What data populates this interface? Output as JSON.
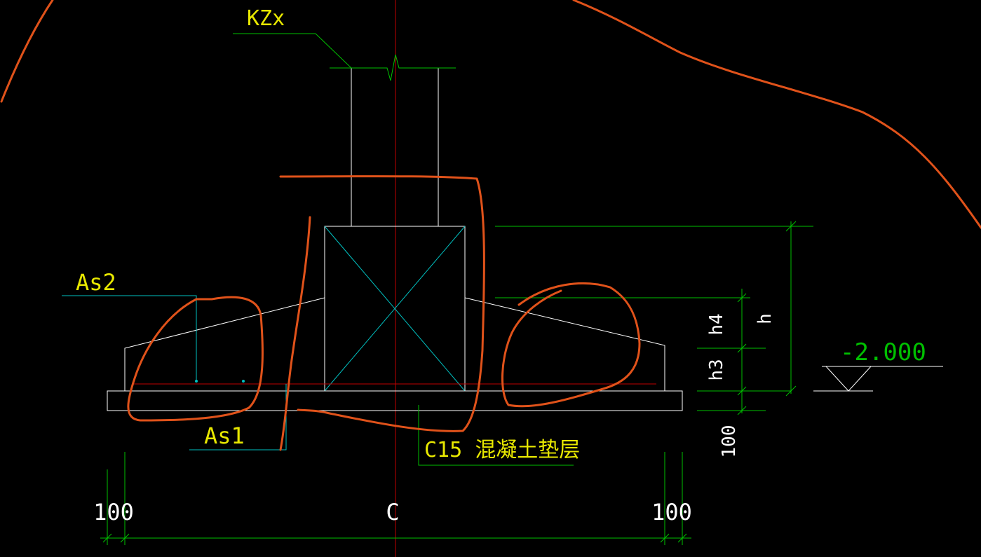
{
  "labels": {
    "column": "KZx",
    "top_rebar": "As2",
    "bottom_rebar": "As1",
    "cushion": "C15 混凝土垫层",
    "elevation": "-2.000",
    "dim_h": "h",
    "dim_h4": "h4",
    "dim_h3": "h3",
    "dim_cushion": "100",
    "dim_left": "100",
    "dim_center": "C",
    "dim_right": "100"
  },
  "colors": {
    "background": "#000000",
    "outline": "#ffffff",
    "leader": "#00c000",
    "dimension": "#00c000",
    "rebar_cyan": "#00c0c0",
    "axis": "#c00000",
    "markup": "#e0521a",
    "text_yellow": "#e8e800"
  }
}
